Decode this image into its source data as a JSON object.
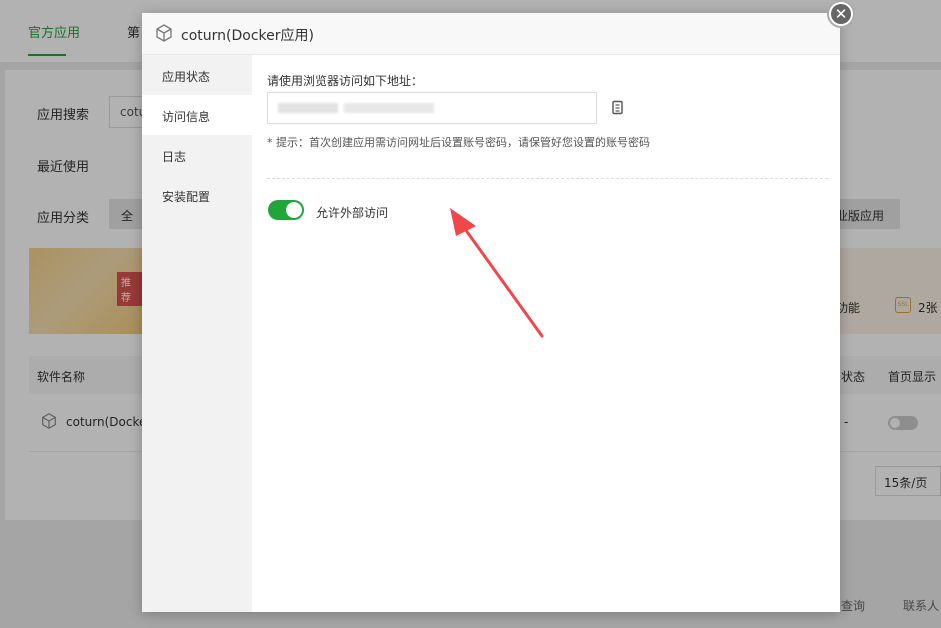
{
  "background": {
    "tabs": [
      "官方应用",
      "第"
    ],
    "search_label": "应用搜索",
    "search_value": "cotu",
    "recent_label": "最近使用",
    "category_label": "应用分类",
    "category_btn": "全",
    "category_btn_right": "业版应用",
    "banner_badge": "推荐",
    "banner_text_right": "功能",
    "banner_ssl_text": "2张",
    "table_header_name": "软件名称",
    "table_header_status": "状态",
    "table_header_home": "首页显示",
    "row_name": "coturn(Docke",
    "row_status": "-",
    "page_size": "15条/页",
    "footer_left": "查询",
    "footer_right": "联系人"
  },
  "modal": {
    "title": "coturn(Docker应用)",
    "close_label": "✕",
    "sidebar": [
      {
        "label": "应用状态",
        "active": false
      },
      {
        "label": "访问信息",
        "active": true
      },
      {
        "label": "日志",
        "active": false
      },
      {
        "label": "安装配置",
        "active": false
      }
    ],
    "access_label": "请使用浏览器访问如下地址：",
    "hint": "* 提示：首次创建应用需访问网址后设置账号密码，请保管好您设置的账号密码",
    "toggle_label": "允许外部访问",
    "toggle_on": true
  },
  "colors": {
    "accent": "#20a53a",
    "arrow": "#f0474b"
  }
}
